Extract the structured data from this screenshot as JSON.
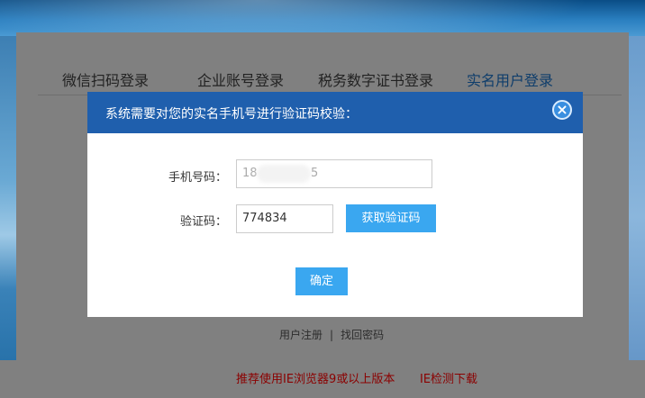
{
  "tabs": [
    {
      "label": "微信扫码登录"
    },
    {
      "label": "企业账号登录"
    },
    {
      "label": "税务数字证书登录"
    },
    {
      "label": "实名用户登录"
    }
  ],
  "footer": {
    "register": "用户注册",
    "separator": "|",
    "recover": "找回密码"
  },
  "warning": {
    "browser_tip": "推荐使用IE浏览器9或以上版本",
    "download": "IE检测下载"
  },
  "modal": {
    "title": "系统需要对您的实名手机号进行验证码校验：",
    "close": "×",
    "phone_label": "手机号码：",
    "phone_prefix": "18",
    "phone_suffix": "5",
    "code_label": "验证码：",
    "code_value": "774834",
    "get_code_button": "获取验证码",
    "confirm_button": "确定"
  },
  "colors": {
    "header": "#1f5fad",
    "accent_button": "#3aa7f0",
    "warning_text": "#8b0000"
  }
}
